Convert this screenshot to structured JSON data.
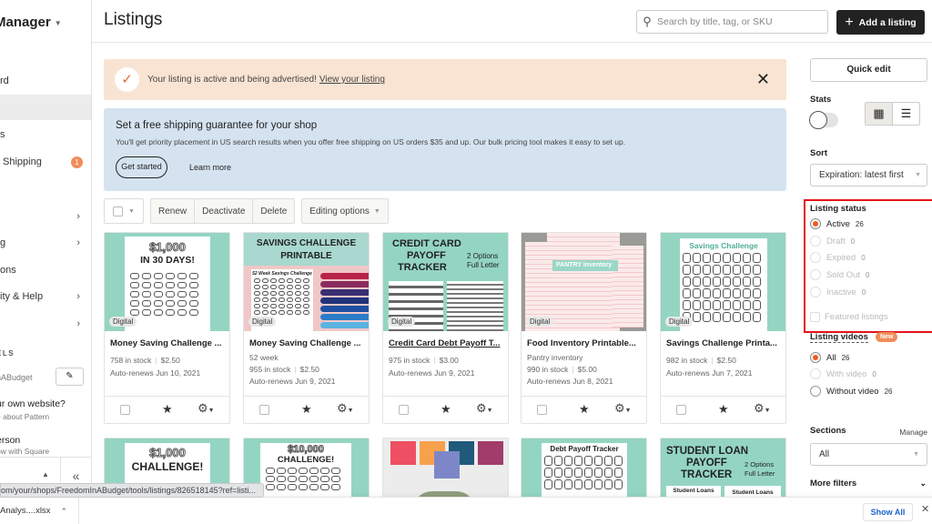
{
  "sidebar": {
    "title": "Manager",
    "items": [
      {
        "label": "rd",
        "active": false
      },
      {
        "label": "",
        "active": true
      },
      {
        "label": "s",
        "active": false
      },
      {
        "label": "Shipping",
        "badge": "1"
      },
      {
        "label": "",
        "chevron": "›"
      },
      {
        "label": "g",
        "chevron": "›"
      },
      {
        "label": "ons"
      },
      {
        "label": "ity & Help",
        "chevron": "›"
      },
      {
        "label": "",
        "chevron": "›"
      }
    ],
    "section_label": "ELS",
    "shop_name": "nABudget",
    "promos": [
      {
        "title": "ur own website?",
        "subtitle": "e about Pattern"
      },
      {
        "title": "erson",
        "subtitle": "ow with Square"
      }
    ],
    "collapse_icon": "«"
  },
  "header": {
    "title": "Listings",
    "search_placeholder": "Search by title, tag, or SKU",
    "add_button": "Add a listing"
  },
  "alert": {
    "message": "Your listing is active and being advertised!",
    "link": "View your listing"
  },
  "promo": {
    "title": "Set a free shipping guarantee for your shop",
    "text": "You'll get priority placement in US search results when you offer free shipping on US orders $35 and up. Our bulk pricing tool makes it easy to set up.",
    "primary_button": "Get started",
    "secondary_link": "Learn more"
  },
  "toolbar": {
    "actions": [
      "Renew",
      "Deactivate",
      "Delete"
    ],
    "editing_options": "Editing options"
  },
  "listings": [
    {
      "title": "Money Saving Challenge ...",
      "subtitle": "",
      "stock": "758 in stock",
      "price": "$2.50",
      "renew": "Auto-renews Jun 10, 2021",
      "badge": "Digital",
      "image_text": [
        "$1,000",
        "IN 30 DAYS!"
      ]
    },
    {
      "title": "Money Saving Challenge ...",
      "subtitle": "52 week",
      "stock": "955 in stock",
      "price": "$2.50",
      "renew": "Auto-renews Jun 9, 2021",
      "badge": "Digital",
      "image_text": [
        "SAVINGS CHALLENGE",
        "PRINTABLE",
        "52 Week Savings Challenge"
      ]
    },
    {
      "title": "Credit Card Debt Payoff T...",
      "subtitle": "",
      "stock": "975 in stock",
      "price": "$3.00",
      "renew": "Auto-renews Jun 9, 2021",
      "badge": "Digital",
      "image_text": [
        "CREDIT CARD",
        "PAYOFF",
        "TRACKER",
        "2 Options",
        "Full Letter"
      ]
    },
    {
      "title": "Food Inventory Printable...",
      "subtitle": "Pantry inventory",
      "stock": "990 in stock",
      "price": "$5.00",
      "renew": "Auto-renews Jun 8, 2021",
      "badge": "Digital",
      "image_text": [
        "PANTRY inventory"
      ]
    },
    {
      "title": "Savings Challenge Printa...",
      "subtitle": "",
      "stock": "982 in stock",
      "price": "$2.50",
      "renew": "Auto-renews Jun 7, 2021",
      "badge": "Digital",
      "image_text": [
        "Savings Challenge"
      ]
    },
    {
      "image_text": [
        "$1,000",
        "CHALLENGE!"
      ]
    },
    {
      "image_text": [
        "$10,000",
        "CHALLENGE!"
      ]
    },
    {
      "image_text": []
    },
    {
      "image_text": [
        "Debt Payoff Tracker"
      ]
    },
    {
      "image_text": [
        "STUDENT LOAN",
        "PAYOFF",
        "TRACKER",
        "2 Options",
        "Full Letter",
        "Student Loans",
        "Student Loans"
      ]
    }
  ],
  "right_panel": {
    "quick_edit": "Quick edit",
    "stats_label": "Stats",
    "stats_enabled": false,
    "sort_label": "Sort",
    "sort_value": "Expiration: latest first",
    "listing_status_label": "Listing status",
    "statuses": [
      {
        "label": "Active",
        "count": "26",
        "selected": true,
        "disabled": false
      },
      {
        "label": "Draft",
        "count": "0",
        "selected": false,
        "disabled": true
      },
      {
        "label": "Expired",
        "count": "0",
        "selected": false,
        "disabled": true
      },
      {
        "label": "Sold Out",
        "count": "0",
        "selected": false,
        "disabled": true
      },
      {
        "label": "Inactive",
        "count": "0",
        "selected": false,
        "disabled": true
      }
    ],
    "featured_label": "Featured listings",
    "videos_label": "Listing videos",
    "new_badge": "New",
    "videos": [
      {
        "label": "All",
        "count": "26",
        "selected": true,
        "disabled": false
      },
      {
        "label": "With video",
        "count": "0",
        "selected": false,
        "disabled": true
      },
      {
        "label": "Without video",
        "count": "26",
        "selected": false,
        "disabled": false
      }
    ],
    "sections_label": "Sections",
    "manage_link": "Manage",
    "sections_value": "All",
    "more_filters": "More filters"
  },
  "browser": {
    "status_url": "om/your/shops/FreedomInABudget/tools/listings/826518145?ref=listi...",
    "download_file": "Analys....xlsx",
    "show_all": "Show All"
  },
  "colors": {
    "accent_orange": "#ee5a1e",
    "alert_bg": "#f9e4d3",
    "promo_bg": "#d5e3f0",
    "highlight_red": "#e3131b",
    "image_mint": "#94d5c2"
  }
}
